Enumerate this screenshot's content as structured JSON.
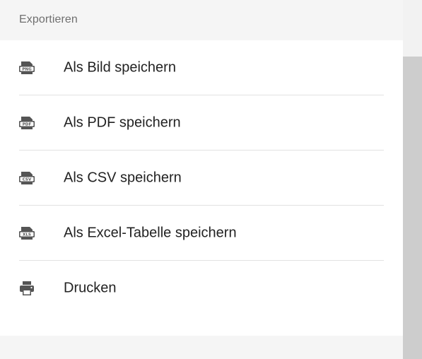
{
  "panel": {
    "header_title": "Exportieren"
  },
  "menu": {
    "items": [
      {
        "label": "Als Bild speichern",
        "icon": "png-file-icon",
        "icon_text": "PNG"
      },
      {
        "label": "Als PDF speichern",
        "icon": "pdf-file-icon",
        "icon_text": "PDF"
      },
      {
        "label": "Als CSV speichern",
        "icon": "csv-file-icon",
        "icon_text": "CSV"
      },
      {
        "label": "Als Excel-Tabelle speichern",
        "icon": "xls-file-icon",
        "icon_text": "XLS"
      },
      {
        "label": "Drucken",
        "icon": "printer-icon"
      }
    ]
  },
  "colors": {
    "header_bg": "#f5f5f5",
    "text": "#222222",
    "header_text": "#6f6f6f",
    "icon": "#555555",
    "divider": "#e2e2e2",
    "scrollbar_thumb": "#cdcdcd"
  }
}
